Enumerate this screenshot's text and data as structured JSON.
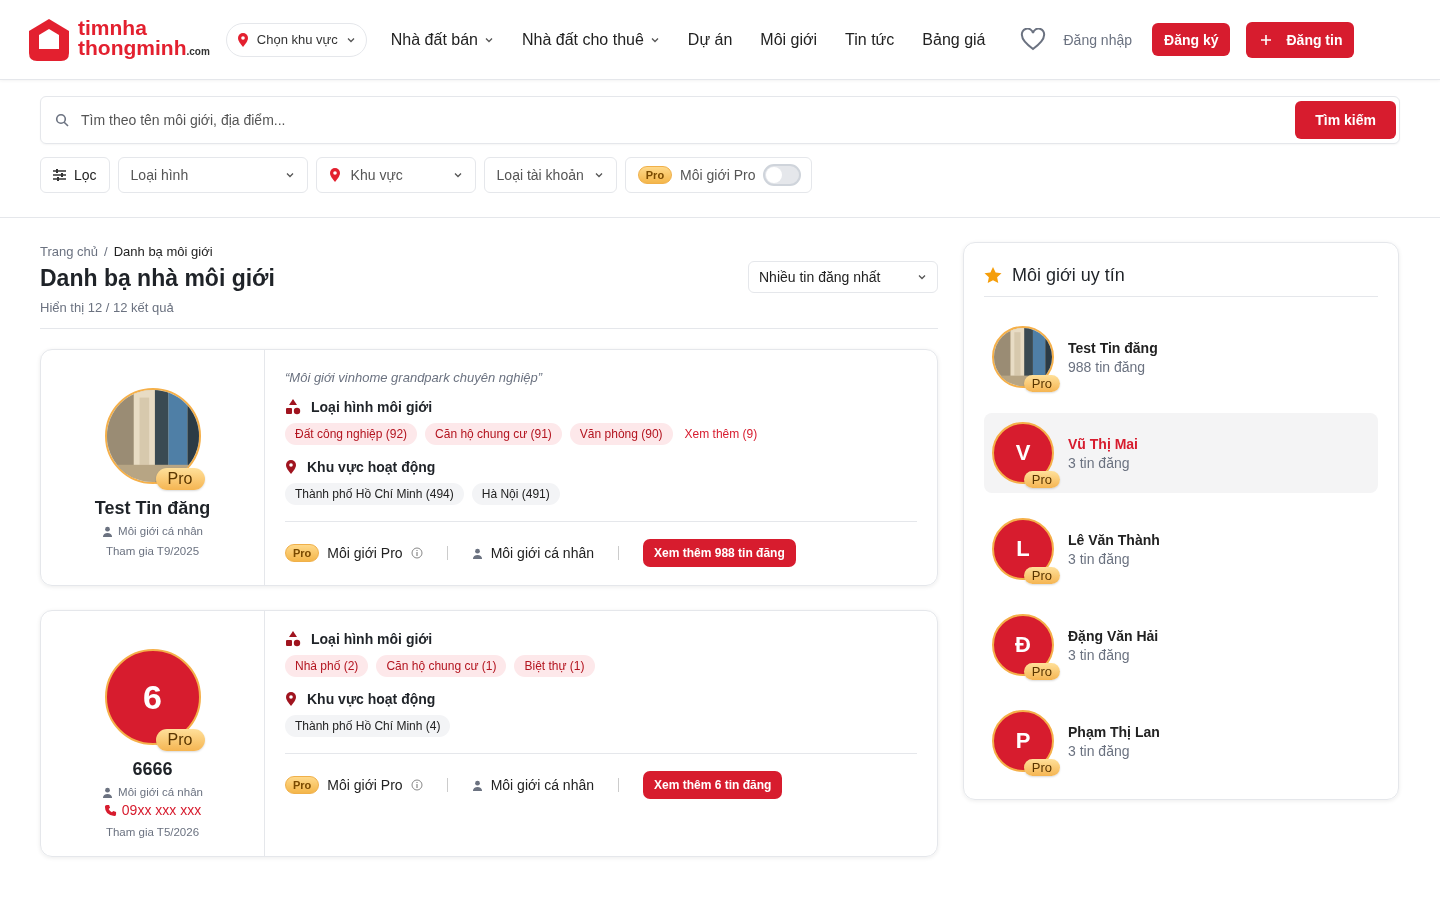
{
  "header": {
    "logo": {
      "line1": "timnha",
      "line2": "thongminh",
      "suffix": ".com"
    },
    "region_picker": "Chọn khu vực",
    "nav": [
      {
        "label": "Nhà đất bán",
        "dropdown": true
      },
      {
        "label": "Nhà đất cho thuê",
        "dropdown": true
      },
      {
        "label": "Dự án",
        "dropdown": false
      },
      {
        "label": "Môi giới",
        "dropdown": false
      },
      {
        "label": "Tin tức",
        "dropdown": false
      },
      {
        "label": "Bảng giá",
        "dropdown": false
      }
    ],
    "login": "Đăng nhập",
    "register": "Đăng ký",
    "post": "Đăng tin"
  },
  "search": {
    "placeholder": "Tìm theo tên môi giới, địa điểm...",
    "button": "Tìm kiếm"
  },
  "filters": {
    "filter": "Lọc",
    "type": "Loại hình",
    "area": "Khu vực",
    "account": "Loại tài khoản",
    "pro_badge": "Pro",
    "pro_label": "Môi giới Pro",
    "pro_on": false
  },
  "breadcrumb": [
    "Trang chủ",
    "Danh bạ môi giới"
  ],
  "breadcrumb_separator": "/",
  "title": "Danh bạ nhà môi giới",
  "results": "Hiển thị 12 / 12 kết quả",
  "sort": "Nhiều tin đăng nhất",
  "brokers": [
    {
      "avatar": {
        "kind": "picture"
      },
      "badge": "Pro",
      "name": "Test Tin đăng",
      "role": "Môi giới cá nhân",
      "joined": "Tham gia T9/2025",
      "quote": "“Môi giới vinhome grandpark chuyên nghiệp”",
      "types_title": "Loại hình môi giới",
      "types": [
        "Đất công nghiệp (92)",
        "Căn hộ chung cư (91)",
        "Văn phòng (90)"
      ],
      "more": "Xem thêm (9)",
      "areas_title": "Khu vực hoạt động",
      "areas": [
        "Thành phố Hồ Chí Minh (494)",
        "Hà Nội (491)"
      ],
      "footer_badge": "Pro",
      "footer_pro": "Môi giới Pro",
      "footer_role": "Môi giới cá nhân",
      "button": "Xem thêm 988 tin đăng"
    },
    {
      "avatar": {
        "kind": "initial",
        "text": "6"
      },
      "badge": "Pro",
      "name": "6666",
      "role": "Môi giới cá nhân",
      "phone": "09xx xxx xxx",
      "joined": "Tham gia T5/2026",
      "types_title": "Loại hình môi giới",
      "types": [
        "Nhà phố (2)",
        "Căn hộ chung cư (1)",
        "Biệt thự (1)"
      ],
      "areas_title": "Khu vực hoạt động",
      "areas": [
        "Thành phố Hồ Chí Minh (4)"
      ],
      "footer_badge": "Pro",
      "footer_pro": "Môi giới Pro",
      "footer_role": "Môi giới cá nhân",
      "button": "Xem thêm 6 tin đăng"
    }
  ],
  "sidebar": {
    "title": "Môi giới uy tín",
    "items": [
      {
        "avatar": {
          "kind": "picture"
        },
        "badge": "Pro",
        "name": "Test Tin đăng",
        "count": "988 tin đăng",
        "selected": false
      },
      {
        "avatar": {
          "kind": "initial",
          "text": "V"
        },
        "badge": "Pro",
        "name": "Vũ Thị Mai",
        "count": "3 tin đăng",
        "selected": true
      },
      {
        "avatar": {
          "kind": "initial",
          "text": "L"
        },
        "badge": "Pro",
        "name": "Lê Văn Thành",
        "count": "3 tin đăng",
        "selected": false
      },
      {
        "avatar": {
          "kind": "initial",
          "text": "Đ"
        },
        "badge": "Pro",
        "name": "Đặng Văn Hải",
        "count": "3 tin đăng",
        "selected": false
      },
      {
        "avatar": {
          "kind": "initial",
          "text": "P"
        },
        "badge": "Pro",
        "name": "Phạm Thị Lan",
        "count": "3 tin đăng",
        "selected": false
      }
    ]
  }
}
